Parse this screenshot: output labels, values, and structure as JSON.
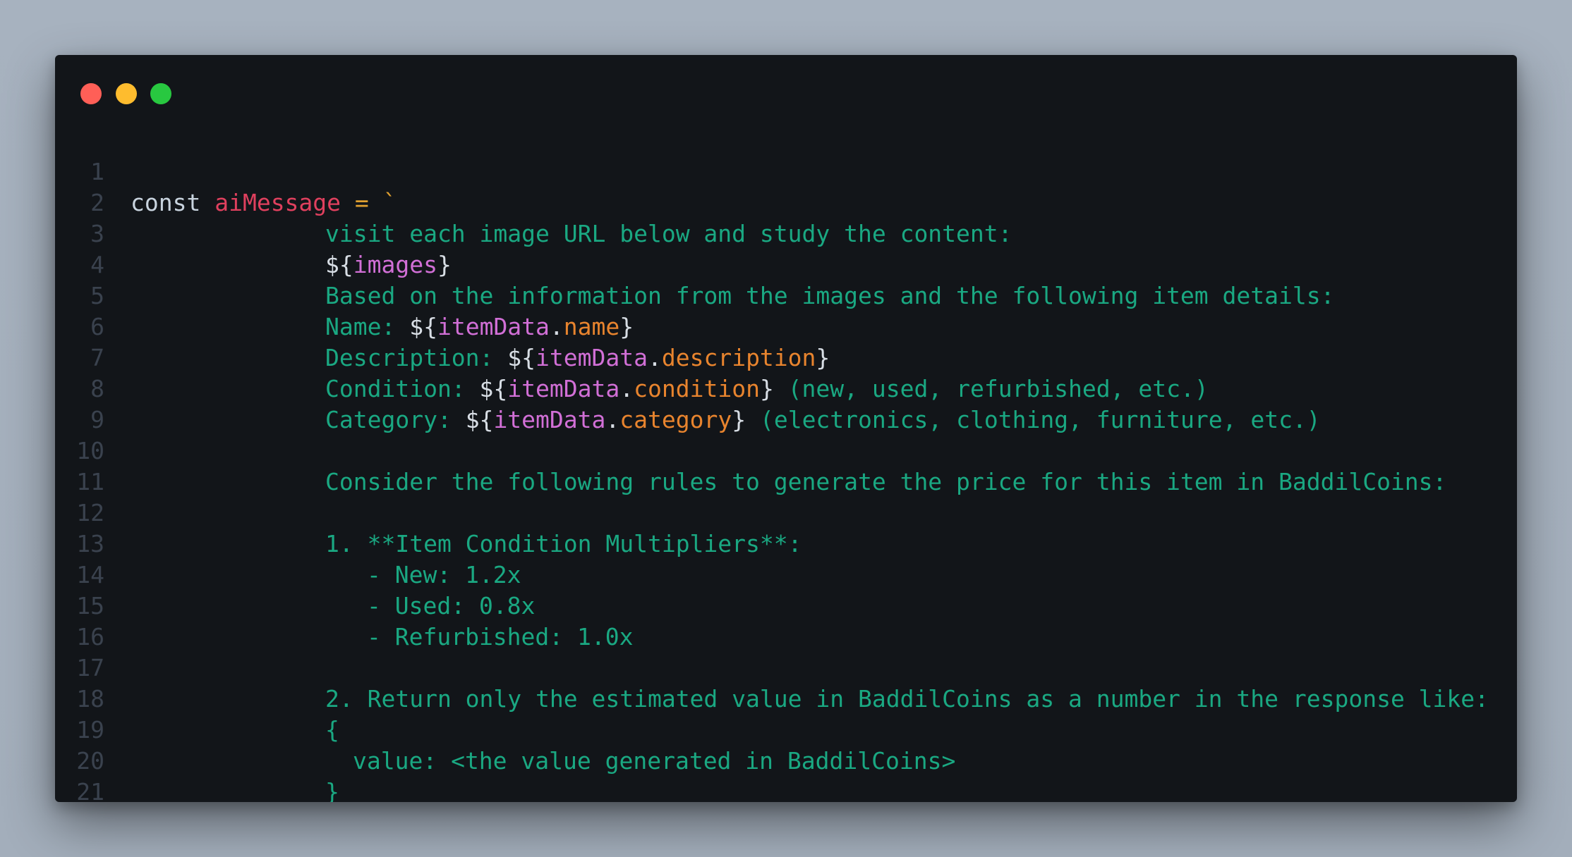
{
  "window": {
    "controls": [
      "close",
      "minimize",
      "maximize"
    ],
    "colors": {
      "background": "#121519",
      "close": "#ff5f57",
      "minimize": "#febc2e",
      "maximize": "#28c840"
    }
  },
  "code": {
    "line_numbers": [
      "1",
      "2",
      "3",
      "4",
      "5",
      "6",
      "7",
      "8",
      "9",
      "10",
      "11",
      "12",
      "13",
      "14",
      "15",
      "16",
      "17",
      "18",
      "19",
      "20",
      "21"
    ],
    "l1": {
      "keyword": "const",
      "name": "aiMessage",
      "assign": "=",
      "tick": "`"
    },
    "l2": "visit each image URL below and study the content:",
    "l3": {
      "open": "${",
      "ident": "images",
      "close": "}"
    },
    "l4": "Based on the information from the images and the following item details:",
    "l5": {
      "label": "Name: ",
      "open": "${",
      "obj": "itemData",
      "dot": ".",
      "prop": "name",
      "close": "}"
    },
    "l6": {
      "label": "Description: ",
      "open": "${",
      "obj": "itemData",
      "dot": ".",
      "prop": "description",
      "close": "}"
    },
    "l7": {
      "label": "Condition: ",
      "open": "${",
      "obj": "itemData",
      "dot": ".",
      "prop": "condition",
      "close": "}",
      "rest": " (new, used, refurbished, etc.)"
    },
    "l8": {
      "label": "Category: ",
      "open": "${",
      "obj": "itemData",
      "dot": ".",
      "prop": "category",
      "close": "}",
      "rest": " (electronics, clothing, furniture, etc.)"
    },
    "l10": "Consider the following rules to generate the price for this item in BaddilCoins:",
    "l12": "1. **Item Condition Multipliers**:",
    "l13": "- New: 1.2x",
    "l14": "- Used: 0.8x",
    "l15": "- Refurbished: 1.0x",
    "l17": "2. Return only the estimated value in BaddilCoins as a number in the response like:",
    "l18": "{",
    "l19": "value: <the value generated in BaddilCoins>",
    "l20": "}",
    "l21": "`;"
  }
}
